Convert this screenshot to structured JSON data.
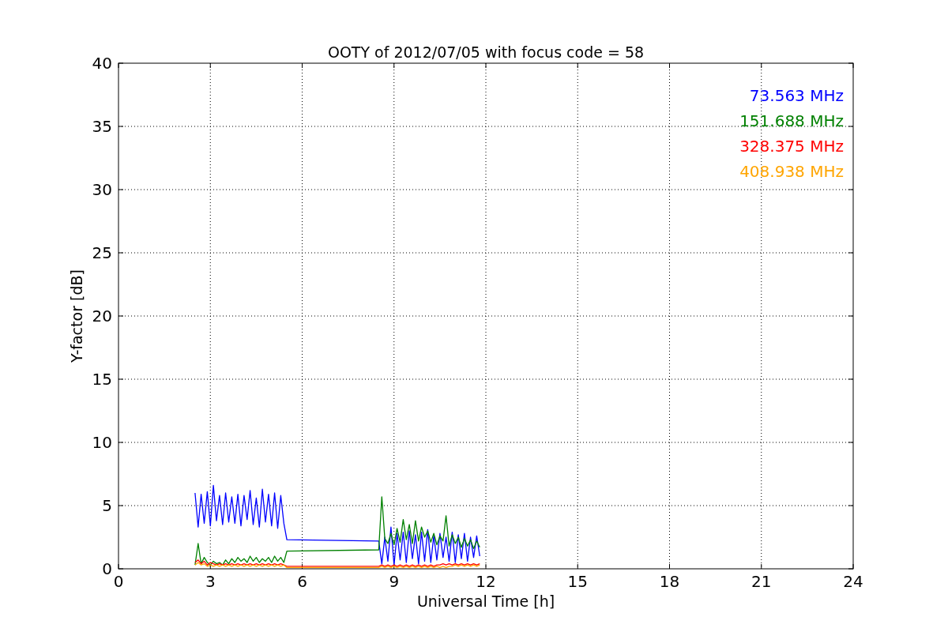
{
  "figure": {
    "chart_data": {
      "type": "line",
      "title": "OOTY of 2012/07/05 with focus code = 58",
      "xlabel": "Universal Time [h]",
      "ylabel": "Y-factor [dB]",
      "x": [
        2.5,
        2.6,
        2.7,
        2.8,
        2.9,
        3.0,
        3.1,
        3.2,
        3.3,
        3.4,
        3.5,
        3.6,
        3.7,
        3.8,
        3.9,
        4.0,
        4.1,
        4.2,
        4.3,
        4.4,
        4.5,
        4.6,
        4.7,
        4.8,
        4.9,
        5.0,
        5.1,
        5.2,
        5.3,
        5.4,
        5.5,
        8.5,
        8.6,
        8.7,
        8.8,
        8.9,
        9.0,
        9.1,
        9.2,
        9.3,
        9.4,
        9.5,
        9.6,
        9.7,
        9.8,
        9.9,
        10.0,
        10.1,
        10.2,
        10.3,
        10.4,
        10.5,
        10.6,
        10.7,
        10.8,
        10.9,
        11.0,
        11.1,
        11.2,
        11.3,
        11.4,
        11.5,
        11.6,
        11.7,
        11.8
      ],
      "series": [
        {
          "name": "73.563 MHz",
          "color": "#0000ff",
          "values": [
            6.0,
            3.3,
            5.9,
            3.6,
            6.1,
            3.4,
            6.6,
            3.8,
            5.8,
            3.5,
            6.0,
            3.7,
            5.7,
            3.6,
            5.9,
            3.4,
            5.8,
            3.9,
            6.2,
            3.5,
            5.6,
            3.3,
            6.3,
            3.7,
            5.9,
            3.4,
            6.0,
            3.2,
            5.8,
            3.6,
            2.3,
            2.2,
            0.4,
            2.5,
            0.6,
            3.3,
            0.3,
            2.8,
            0.7,
            2.9,
            0.5,
            3.0,
            0.8,
            2.7,
            0.4,
            2.9,
            0.6,
            3.1,
            0.5,
            2.6,
            0.7,
            2.8,
            0.9,
            2.5,
            0.6,
            2.9,
            0.5,
            2.7,
            0.8,
            2.8,
            0.6,
            2.5,
            0.9,
            2.6,
            1.0
          ]
        },
        {
          "name": "151.688 MHz",
          "color": "#008000",
          "values": [
            0.3,
            2.0,
            0.4,
            0.9,
            0.5,
            0.3,
            0.6,
            0.4,
            0.5,
            0.3,
            0.7,
            0.4,
            0.8,
            0.5,
            0.9,
            0.6,
            0.8,
            0.5,
            1.0,
            0.6,
            0.9,
            0.5,
            0.8,
            0.6,
            0.9,
            0.5,
            1.0,
            0.6,
            0.9,
            0.5,
            1.4,
            1.5,
            5.7,
            2.4,
            2.0,
            2.8,
            1.9,
            3.2,
            2.1,
            3.9,
            2.3,
            3.5,
            2.0,
            3.8,
            2.2,
            3.3,
            2.5,
            3.0,
            2.1,
            2.8,
            1.9,
            2.6,
            2.2,
            4.2,
            1.8,
            2.7,
            2.0,
            2.5,
            1.7,
            2.4,
            1.8,
            2.3,
            1.6,
            2.2,
            1.7
          ]
        },
        {
          "name": "328.375 MHz",
          "color": "#ff0000",
          "values": [
            0.5,
            0.7,
            0.4,
            0.6,
            0.3,
            0.5,
            0.4,
            0.3,
            0.4,
            0.3,
            0.4,
            0.3,
            0.4,
            0.3,
            0.4,
            0.3,
            0.4,
            0.3,
            0.4,
            0.3,
            0.4,
            0.3,
            0.4,
            0.3,
            0.4,
            0.3,
            0.4,
            0.3,
            0.4,
            0.3,
            0.2,
            0.2,
            0.3,
            0.2,
            0.3,
            0.2,
            0.3,
            0.2,
            0.3,
            0.2,
            0.3,
            0.2,
            0.3,
            0.2,
            0.3,
            0.2,
            0.3,
            0.2,
            0.3,
            0.2,
            0.3,
            0.3,
            0.4,
            0.3,
            0.4,
            0.3,
            0.4,
            0.3,
            0.4,
            0.3,
            0.4,
            0.3,
            0.4,
            0.3,
            0.4
          ]
        },
        {
          "name": "408.938 MHz",
          "color": "#ffa500",
          "values": [
            0.3,
            0.5,
            0.3,
            0.4,
            0.2,
            0.3,
            0.2,
            0.3,
            0.2,
            0.3,
            0.2,
            0.3,
            0.2,
            0.3,
            0.2,
            0.3,
            0.2,
            0.3,
            0.2,
            0.3,
            0.2,
            0.3,
            0.2,
            0.3,
            0.2,
            0.3,
            0.2,
            0.3,
            0.2,
            0.3,
            0.1,
            0.1,
            0.2,
            0.1,
            0.2,
            0.1,
            0.2,
            0.1,
            0.2,
            0.1,
            0.2,
            0.1,
            0.2,
            0.1,
            0.2,
            0.1,
            0.2,
            0.1,
            0.2,
            0.1,
            0.2,
            0.1,
            0.2,
            0.1,
            0.2,
            0.2,
            0.3,
            0.2,
            0.3,
            0.2,
            0.3,
            0.2,
            0.3,
            0.2,
            0.3
          ]
        }
      ],
      "grid": true,
      "xlim": [
        0,
        24
      ],
      "ylim": [
        0,
        40
      ],
      "xticks": [
        0,
        3,
        6,
        9,
        12,
        15,
        18,
        21,
        24
      ],
      "yticks": [
        0,
        5,
        10,
        15,
        20,
        25,
        30,
        35,
        40
      ]
    }
  }
}
